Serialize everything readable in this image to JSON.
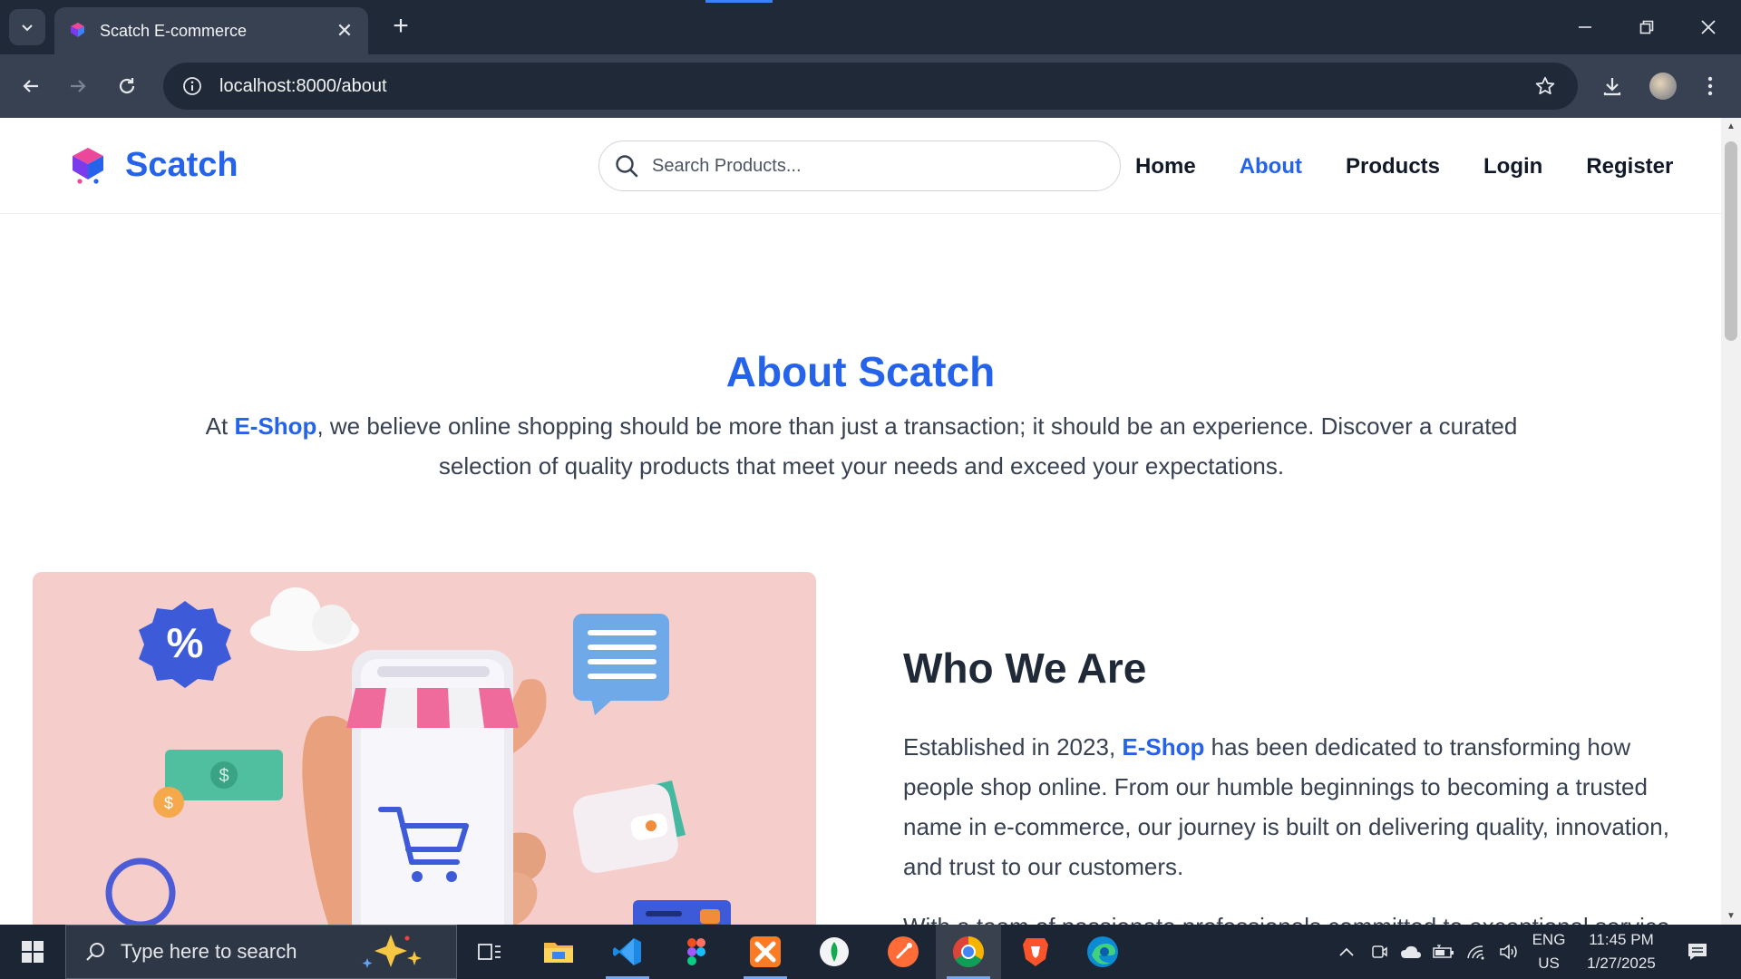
{
  "browser": {
    "tab_title": "Scatch E-commerce",
    "url": "localhost:8000/about"
  },
  "site": {
    "brand": "Scatch",
    "search_placeholder": "Search Products...",
    "nav": [
      "Home",
      "About",
      "Products",
      "Login",
      "Register"
    ],
    "active_nav": "About",
    "accent_color": "#2563eb"
  },
  "about": {
    "title": "About Scatch",
    "intro_prefix": "At ",
    "intro_highlight": "E-Shop",
    "intro_rest": ", we believe online shopping should be more than just a transaction; it should be an experience. Discover a curated selection of quality products that meet your needs and exceed your expectations."
  },
  "who": {
    "title": "Who We Are",
    "p1_prefix": "Established in 2023, ",
    "p1_highlight": "E-Shop",
    "p1_rest": " has been dedicated to transforming how people shop online. From our humble beginnings to becoming a trusted name in e-commerce, our journey is built on delivering quality, innovation, and trust to our customers.",
    "p2_partial": "With a team of passionate professionals committed to exceptional service, we strive to offer"
  },
  "taskbar": {
    "search_placeholder": "Type here to search",
    "language": "ENG",
    "region": "US",
    "time": "11:45 PM",
    "date": "1/27/2025"
  }
}
